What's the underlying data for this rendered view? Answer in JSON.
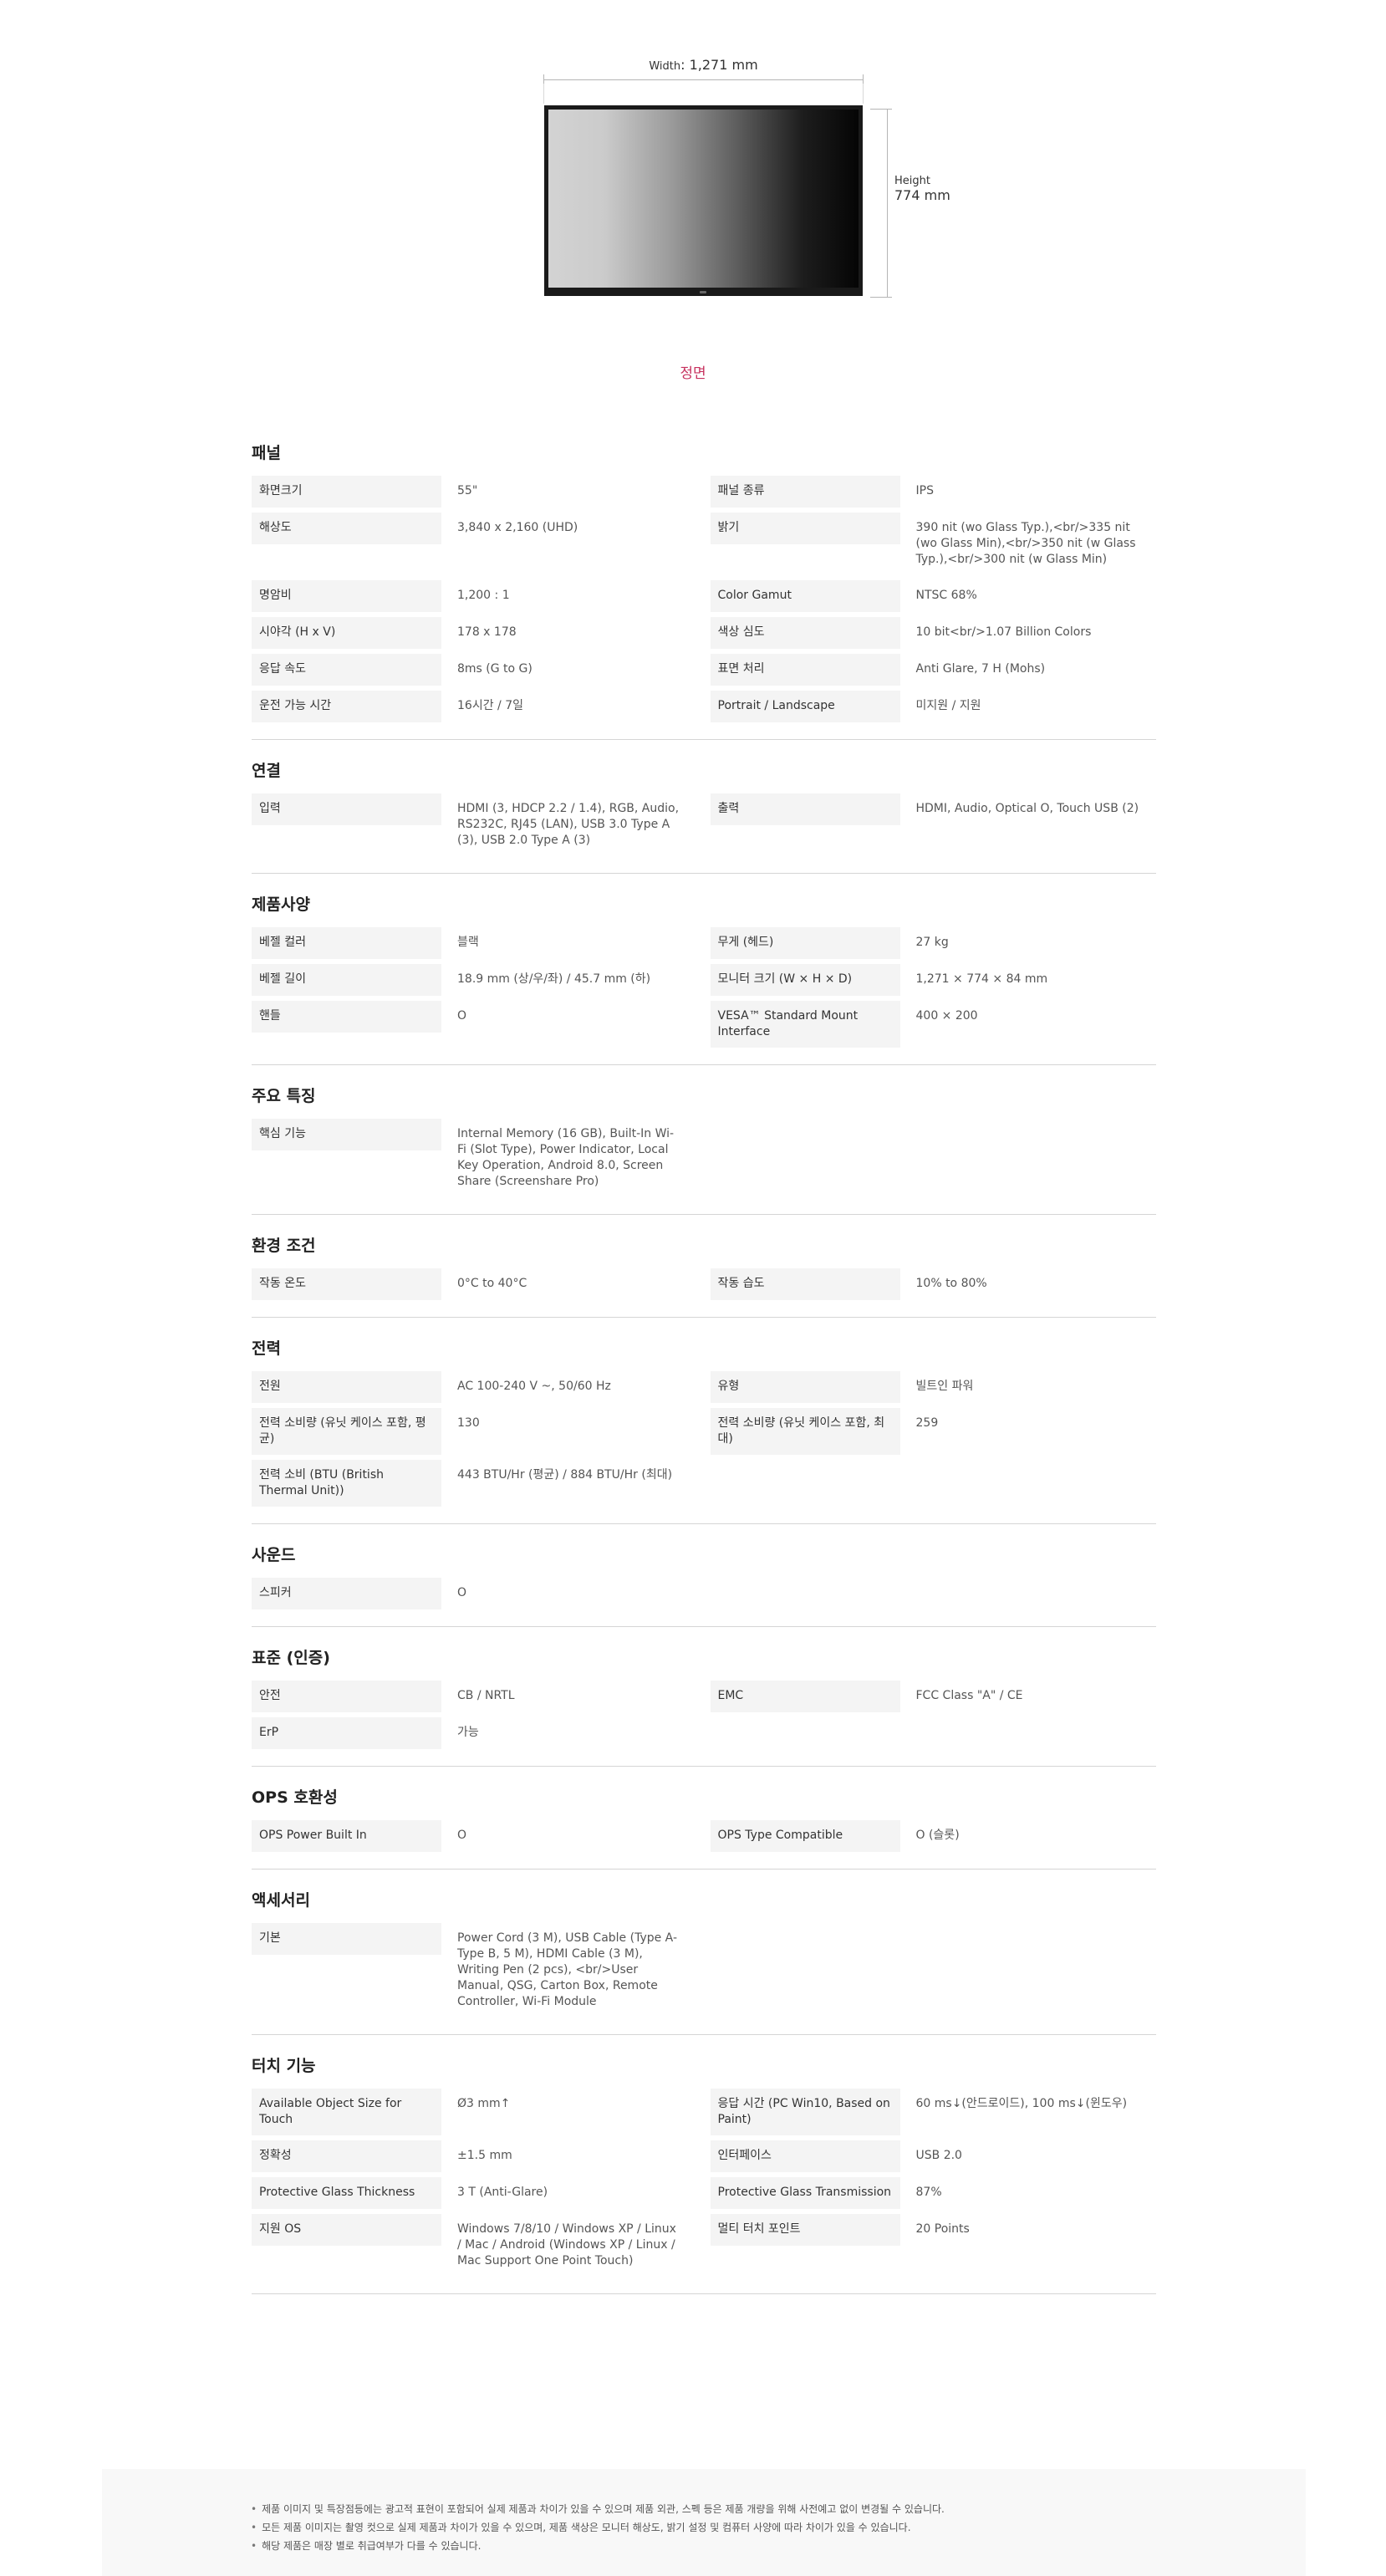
{
  "figure": {
    "width_key": "Width",
    "width_value": ": 1,271 mm",
    "height_key": "Height",
    "height_value": "774 mm",
    "caption": "정면"
  },
  "sections": [
    {
      "title": "패널",
      "rows": [
        [
          {
            "k": "화면크기",
            "v": "55\""
          },
          {
            "k": "패널 종류",
            "v": "IPS"
          }
        ],
        [
          {
            "k": "해상도",
            "v": "3,840 x 2,160 (UHD)"
          },
          {
            "k": "밝기",
            "v": "390 nit (wo Glass Typ.),<br/>335 nit (wo Glass Min),<br/>350 nit (w Glass Typ.),<br/>300 nit (w Glass Min)"
          }
        ],
        [
          {
            "k": "명암비",
            "v": "1,200 : 1"
          },
          {
            "k": "Color Gamut",
            "v": "NTSC 68%"
          }
        ],
        [
          {
            "k": "시야각 (H x V)",
            "v": "178 x 178"
          },
          {
            "k": "색상 심도",
            "v": "10 bit<br/>1.07 Billion Colors"
          }
        ],
        [
          {
            "k": "응답 속도",
            "v": "8ms (G to G)"
          },
          {
            "k": "표면 처리",
            "v": "Anti Glare, 7 H (Mohs)"
          }
        ],
        [
          {
            "k": "운전 가능 시간",
            "v": "16시간 / 7일"
          },
          {
            "k": "Portrait / Landscape",
            "v": "미지원 / 지원"
          }
        ]
      ]
    },
    {
      "title": "연결",
      "rows": [
        [
          {
            "k": "입력",
            "v": "HDMI (3, HDCP 2.2 / 1.4), RGB, Audio, RS232C, RJ45 (LAN), USB 3.0 Type A (3), USB 2.0 Type A (3)"
          },
          {
            "k": "출력",
            "v": "HDMI, Audio, Optical O, Touch USB (2)"
          }
        ]
      ]
    },
    {
      "title": "제품사양",
      "rows": [
        [
          {
            "k": "베젤 컬러",
            "v": "블랙"
          },
          {
            "k": "무게 (헤드)",
            "v": "27 kg"
          }
        ],
        [
          {
            "k": "베젤 길이",
            "v": "18.9 mm (상/우/좌) / 45.7 mm (하)"
          },
          {
            "k": "모니터 크기 (W × H × D)",
            "v": "1,271 × 774 × 84 mm"
          }
        ],
        [
          {
            "k": "핸들",
            "v": "O"
          },
          {
            "k": "VESA™ Standard Mount Interface",
            "v": "400 × 200"
          }
        ]
      ]
    },
    {
      "title": "주요 특징",
      "rows": [
        [
          {
            "k": "핵심 기능",
            "v": "Internal Memory (16 GB), Built-In Wi-Fi (Slot Type), Power Indicator, Local Key Operation, Android 8.0, Screen Share (Screenshare Pro)"
          },
          null
        ]
      ]
    },
    {
      "title": "환경 조건",
      "rows": [
        [
          {
            "k": "작동 온도",
            "v": "0°C to 40°C"
          },
          {
            "k": "작동 습도",
            "v": "10% to 80%"
          }
        ]
      ]
    },
    {
      "title": "전력",
      "rows": [
        [
          {
            "k": "전원",
            "v": "AC 100-240 V ~, 50/60 Hz"
          },
          {
            "k": "유형",
            "v": "빌트인 파워"
          }
        ],
        [
          {
            "k": "전력 소비량 (유닛 케이스 포함, 평균)",
            "v": "130"
          },
          {
            "k": "전력 소비량 (유닛 케이스 포함, 최대)",
            "v": "259"
          }
        ],
        [
          {
            "k": "전력 소비 (BTU (British Thermal Unit))",
            "v": "443 BTU/Hr (평균) / 884 BTU/Hr (최대)"
          },
          null
        ]
      ]
    },
    {
      "title": "사운드",
      "rows": [
        [
          {
            "k": "스피커",
            "v": "O"
          },
          null
        ]
      ]
    },
    {
      "title": "표준 (인증)",
      "rows": [
        [
          {
            "k": "안전",
            "v": "CB / NRTL"
          },
          {
            "k": "EMC",
            "v": "FCC Class \"A\" / CE"
          }
        ],
        [
          {
            "k": "ErP",
            "v": "가능"
          },
          null
        ]
      ]
    },
    {
      "title": "OPS 호환성",
      "rows": [
        [
          {
            "k": "OPS Power Built In",
            "v": "O"
          },
          {
            "k": "OPS Type Compatible",
            "v": "O (슬롯)"
          }
        ]
      ]
    },
    {
      "title": "액세서리",
      "rows": [
        [
          {
            "k": "기본",
            "v": "Power Cord (3 M), USB Cable (Type A-Type B, 5 M), HDMI Cable (3 M), Writing Pen (2 pcs), <br/>User Manual, QSG, Carton Box, Remote Controller, Wi-Fi Module"
          },
          null
        ]
      ]
    },
    {
      "title": "터치 기능",
      "rows": [
        [
          {
            "k": "Available Object Size for Touch",
            "v": "Ø3 mm↑"
          },
          {
            "k": "응답 시간 (PC Win10, Based on Paint)",
            "v": "60 ms↓(안드로이드), 100 ms↓(윈도우)"
          }
        ],
        [
          {
            "k": "정확성",
            "v": "±1.5 mm"
          },
          {
            "k": "인터페이스",
            "v": "USB 2.0"
          }
        ],
        [
          {
            "k": "Protective Glass Thickness",
            "v": "3 T (Anti-Glare)"
          },
          {
            "k": "Protective Glass Transmission",
            "v": "87%"
          }
        ],
        [
          {
            "k": "지원 OS",
            "v": "Windows 7/8/10 / Windows XP / Linux / Mac / Android (Windows XP / Linux / Mac Support One Point Touch)"
          },
          {
            "k": "멀티 터치 포인트",
            "v": "20 Points"
          }
        ]
      ]
    }
  ],
  "notes": [
    "제품 이미지 및 특장점등에는 광고적 표현이 포함되어 실제 제품과 차이가 있을 수 있으며 제품 외관, 스펙 등은 제품 개량을 위해 사전예고 없이 변경될 수 있습니다.",
    "모든 제품 이미지는 촬영 컷으로 실제 제품과 차이가 있을 수 있으며, 제품 색상은 모니터 해상도, 밝기 설정 및 컴퓨터 사양에 따라 차이가 있을 수 있습니다.",
    "해당 제품은 매장 별로 취급여부가 다를 수 있습니다."
  ]
}
